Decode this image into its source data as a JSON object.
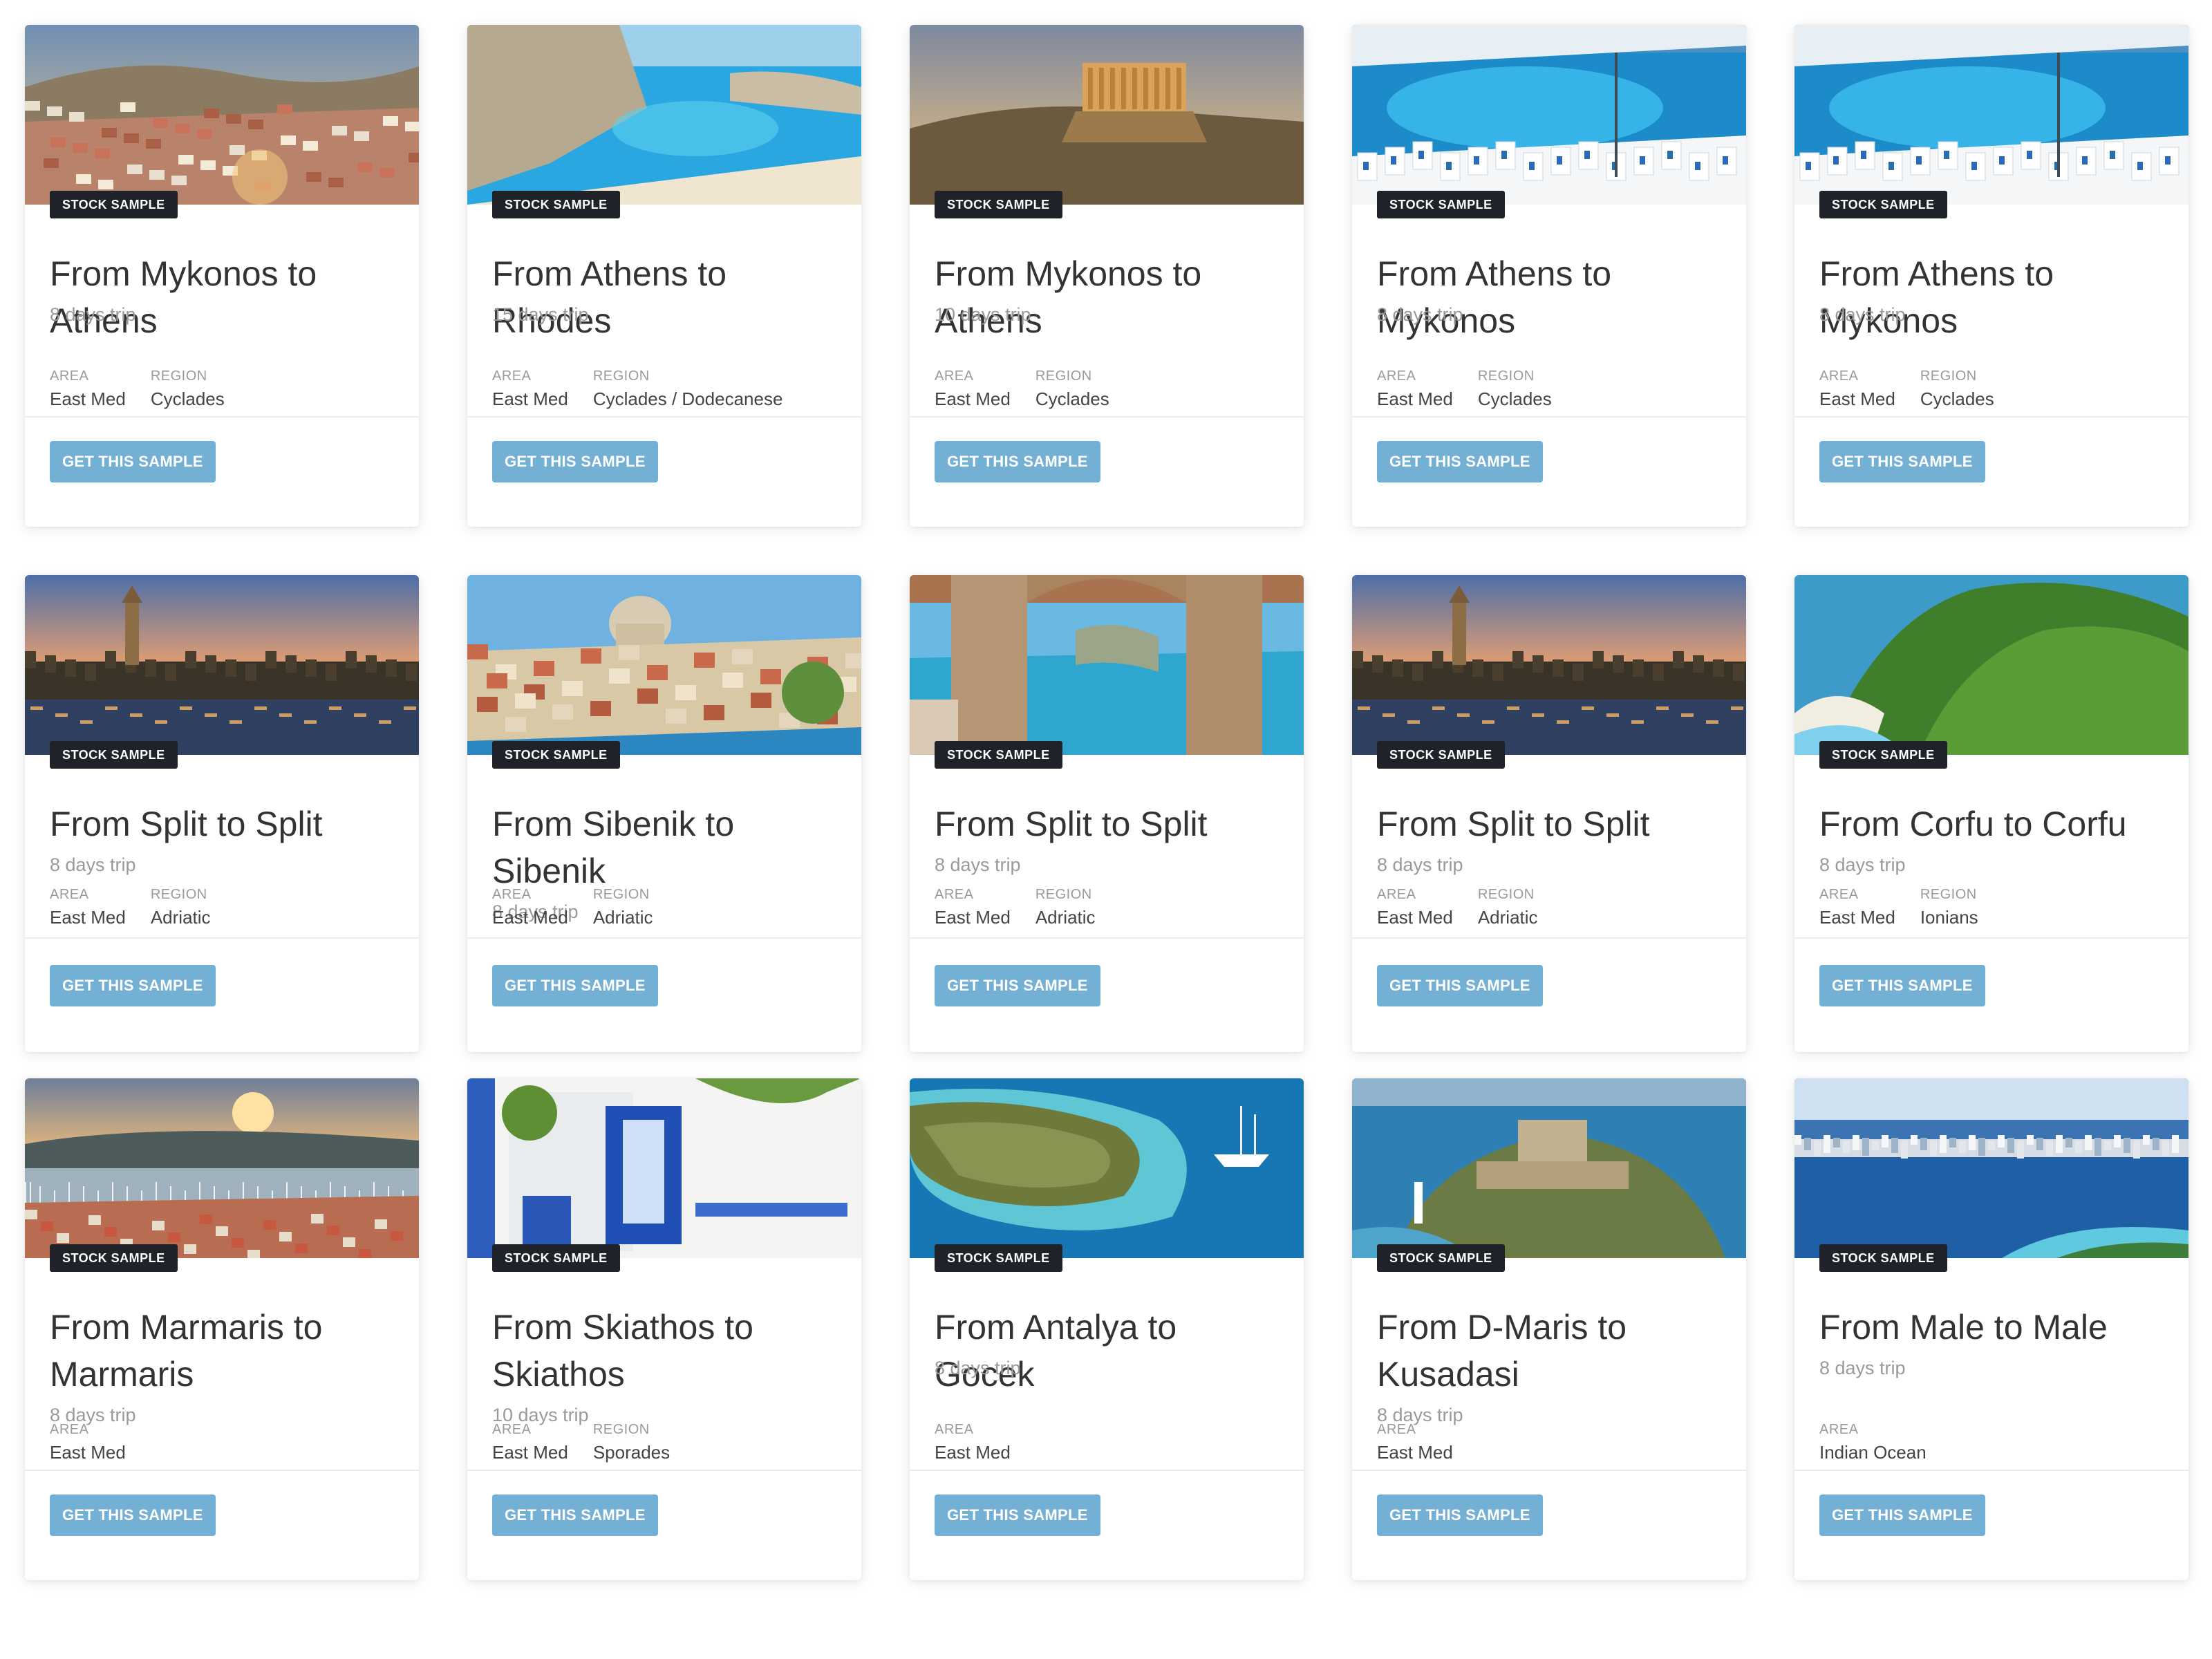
{
  "badge_text": "STOCK SAMPLE",
  "button_text": "GET THIS SAMPLE",
  "area_label": "AREA",
  "region_label": "REGION",
  "rows": [
    {
      "cards": [
        {
          "title": "From Mykonos to Athens",
          "days": "8 days trip",
          "area": "East Med",
          "region": "Cyclades",
          "image": "athens-hillside-photo"
        },
        {
          "title": "From Athens to Rhodes",
          "days": "15 days trip",
          "area": "East Med",
          "region": "Cyclades / Dodecanese",
          "image": "rhodes-bay-photo"
        },
        {
          "title": "From Mykonos to Athens",
          "days": "10 days trip",
          "area": "East Med",
          "region": "Cyclades",
          "image": "acropolis-photo"
        },
        {
          "title": "From Athens to Mykonos",
          "days": "8 days trip",
          "area": "East Med",
          "region": "Cyclades",
          "image": "mykonos-harbour-photo"
        },
        {
          "title": "From Athens to Mykonos",
          "days": "8 days trip",
          "area": "East Med",
          "region": "Cyclades",
          "image": "mykonos-harbour-photo"
        }
      ]
    },
    {
      "cards": [
        {
          "title": "From Split to Split",
          "days": "8 days trip",
          "area": "East Med",
          "region": "Adriatic",
          "image": "split-sunset-photo"
        },
        {
          "title": "From Sibenik to Sibenik",
          "days": "8 days trip",
          "area": "East Med",
          "region": "Adriatic",
          "image": "sibenik-old-town-photo"
        },
        {
          "title": "From Split to Split",
          "days": "8 days trip",
          "area": "East Med",
          "region": "Adriatic",
          "image": "split-arches-photo"
        },
        {
          "title": "From Split to Split",
          "days": "8 days trip",
          "area": "East Med",
          "region": "Adriatic",
          "image": "split-sunset-photo"
        },
        {
          "title": "From Corfu to Corfu",
          "days": "8 days trip",
          "area": "East Med",
          "region": "Ionians",
          "image": "corfu-coast-photo"
        }
      ]
    },
    {
      "cards": [
        {
          "title": "From Marmaris to Marmaris",
          "days": "8 days trip",
          "area": "East Med",
          "region": "",
          "image": "marmaris-marina-photo"
        },
        {
          "title": "From Skiathos to Skiathos",
          "days": "10 days trip",
          "area": "East Med",
          "region": "Sporades",
          "image": "skiathos-courtyard-photo"
        },
        {
          "title": "From Antalya to Gocek",
          "days": "8 days trip",
          "area": "East Med",
          "region": "",
          "image": "gocek-islet-photo"
        },
        {
          "title": "From D-Maris to Kusadasi",
          "days": "8 days trip",
          "area": "East Med",
          "region": "",
          "image": "kusadasi-castle-photo"
        },
        {
          "title": "From Male to Male",
          "days": "8 days trip",
          "area": "Indian Ocean",
          "region": "",
          "image": "male-atoll-photo"
        }
      ]
    }
  ]
}
